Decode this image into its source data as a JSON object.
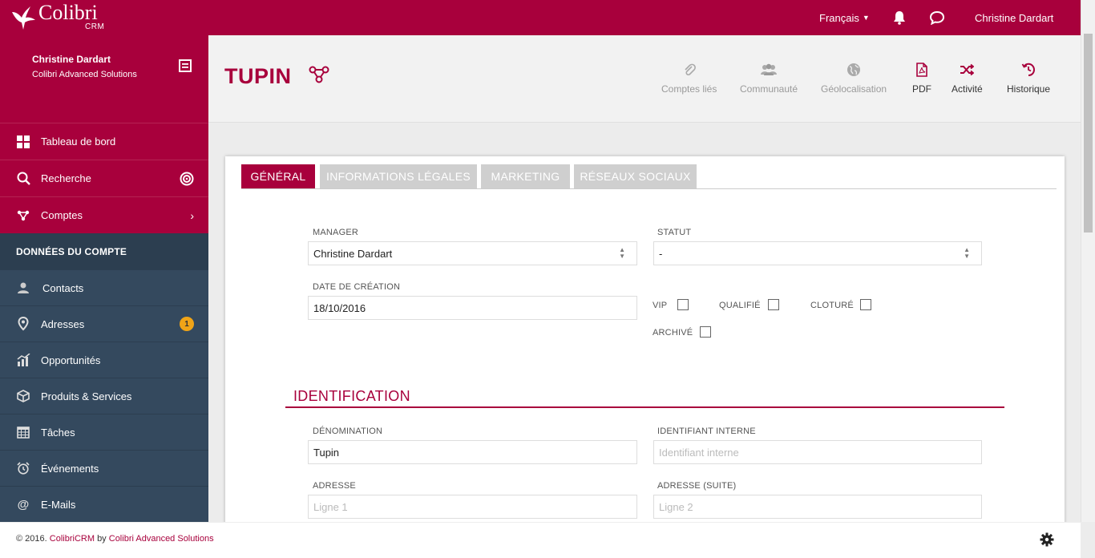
{
  "app": {
    "brand": "Colibri",
    "sub": "CRM"
  },
  "topbar": {
    "language": "Français",
    "user": "Christine Dardart"
  },
  "profile": {
    "name": "Christine Dardart",
    "company": "Colibri Advanced Solutions"
  },
  "nav_top": [
    {
      "label": "Tableau de bord",
      "icon": "dashboard-icon"
    },
    {
      "label": "Recherche",
      "icon": "search-icon"
    },
    {
      "label": "Comptes",
      "icon": "accounts-icon"
    }
  ],
  "section_header": "DONNÉES DU COMPTE",
  "nav_section": [
    {
      "label": "Contacts",
      "icon": "contacts-icon"
    },
    {
      "label": "Adresses",
      "icon": "location-pin-icon",
      "badge": "1"
    },
    {
      "label": "Opportunités",
      "icon": "chart-icon"
    },
    {
      "label": "Produits & Services",
      "icon": "cube-icon"
    },
    {
      "label": "Tâches",
      "icon": "calendar-icon"
    },
    {
      "label": "Événements",
      "icon": "alarm-icon"
    },
    {
      "label": "E-Mails",
      "icon": "at-icon"
    }
  ],
  "page": {
    "title": "TUPIN"
  },
  "actions": [
    {
      "label": "Comptes liés",
      "icon": "paperclip-icon",
      "state": "disabled"
    },
    {
      "label": "Communauté",
      "icon": "users-icon",
      "state": "disabled"
    },
    {
      "label": "Géolocalisation",
      "icon": "globe-icon",
      "state": "disabled"
    },
    {
      "label": "PDF",
      "icon": "pdf-icon",
      "state": "enabled"
    },
    {
      "label": "Activité",
      "icon": "shuffle-icon",
      "state": "enabled"
    },
    {
      "label": "Historique",
      "icon": "history-icon",
      "state": "enabled"
    }
  ],
  "tabs": [
    {
      "label": "GÉNÉRAL",
      "active": true
    },
    {
      "label": "INFORMATIONS LÉGALES",
      "active": false
    },
    {
      "label": "MARKETING",
      "active": false
    },
    {
      "label": "RÉSEAUX SOCIAUX",
      "active": false
    }
  ],
  "form": {
    "manager": {
      "label": "MANAGER",
      "value": "Christine Dardart"
    },
    "statut": {
      "label": "STATUT",
      "value": "-"
    },
    "date_creation": {
      "label": "DATE DE CRÉATION",
      "value": "18/10/2016"
    },
    "checkboxes": [
      {
        "label": "VIP",
        "checked": false
      },
      {
        "label": "QUALIFIÉ",
        "checked": false
      },
      {
        "label": "CLOTURÉ",
        "checked": false
      },
      {
        "label": "ARCHIVÉ",
        "checked": false
      }
    ]
  },
  "identification": {
    "title": "IDENTIFICATION",
    "denomination": {
      "label": "DÉNOMINATION",
      "value": "Tupin"
    },
    "identifiant": {
      "label": "IDENTIFIANT INTERNE",
      "placeholder": "Identifiant interne"
    },
    "adresse": {
      "label": "ADRESSE",
      "placeholder": "Ligne 1"
    },
    "adresse_suite": {
      "label": "ADRESSE (SUITE)",
      "placeholder": "Ligne 2"
    }
  },
  "footer": {
    "copy": "© 2016.",
    "product": "ColibriCRM",
    "by": "by",
    "company": "Colibri Advanced Solutions"
  },
  "colors": {
    "brand": "#a8003c",
    "sidebar": "#34495e",
    "badge": "#f0a417"
  }
}
